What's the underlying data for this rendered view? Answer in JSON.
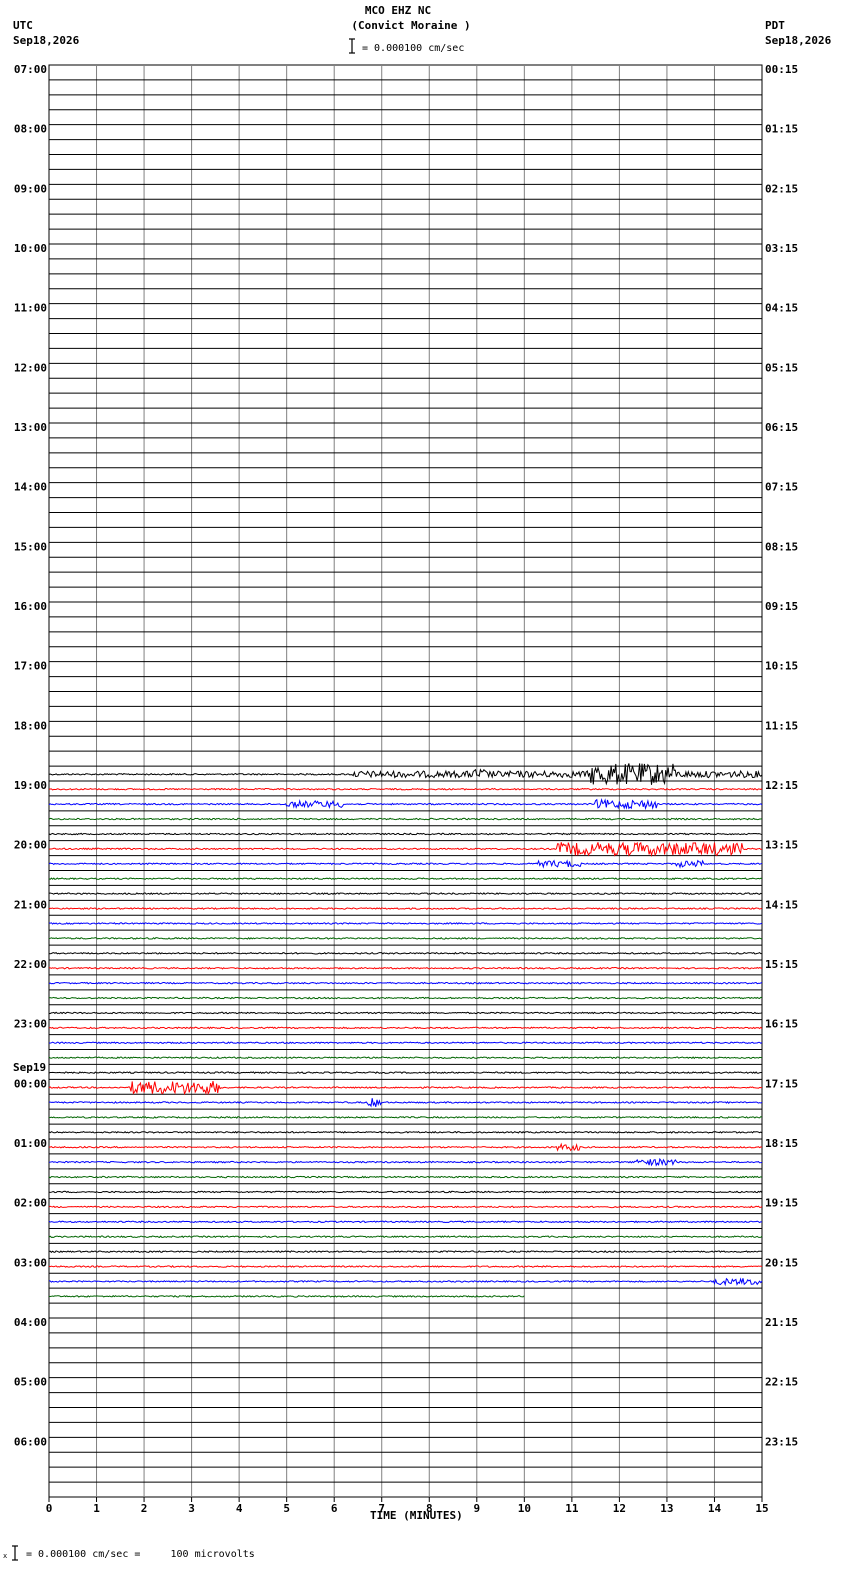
{
  "header": {
    "station": "MCO EHZ NC",
    "location": "(Convict Moraine )",
    "scale": "= 0.000100 cm/sec",
    "left_tz": "UTC",
    "left_date": "Sep18,2026",
    "right_tz": "PDT",
    "right_date": "Sep18,2026",
    "day_change": "Sep19"
  },
  "footer": {
    "scale_note": "= 0.000100 cm/sec =     100 microvolts"
  },
  "colors": {
    "trace_cycle": [
      "#000000",
      "#ff0000",
      "#0000ff",
      "#006400"
    ],
    "grid": "#000000",
    "minute_lines": "#808080"
  },
  "chart_data": {
    "type": "line",
    "title": "MCO EHZ NC (Convict Moraine )",
    "xlabel": "TIME (MINUTES)",
    "ylabel": "",
    "xlim": [
      0,
      15
    ],
    "x_ticks": [
      "0",
      "1",
      "2",
      "3",
      "4",
      "5",
      "6",
      "7",
      "8",
      "9",
      "10",
      "11",
      "12",
      "13",
      "14",
      "15"
    ],
    "rows_per_hour": 4,
    "minutes_per_row": 15,
    "utc_hour_labels": [
      "07:00",
      "08:00",
      "09:00",
      "10:00",
      "11:00",
      "12:00",
      "13:00",
      "14:00",
      "15:00",
      "16:00",
      "17:00",
      "18:00",
      "19:00",
      "20:00",
      "21:00",
      "22:00",
      "23:00",
      "00:00",
      "01:00",
      "02:00",
      "03:00",
      "04:00",
      "05:00",
      "06:00"
    ],
    "pdt_hour_labels": [
      "00:15",
      "01:15",
      "02:15",
      "03:15",
      "04:15",
      "05:15",
      "06:15",
      "07:15",
      "08:15",
      "09:15",
      "10:15",
      "11:15",
      "12:15",
      "13:15",
      "14:15",
      "15:15",
      "16:15",
      "17:15",
      "18:15",
      "19:15",
      "20:15",
      "21:15",
      "22:15",
      "23:15"
    ],
    "trace_rows": {
      "first_row": 47,
      "last_row": 82,
      "last_row_end_minute": 10
    },
    "events": [
      {
        "row": 47,
        "start_min": 6.4,
        "end_min": 15,
        "level": 3,
        "note": "green burst"
      },
      {
        "row": 47,
        "start_min": 11.4,
        "end_min": 13.2,
        "level": 10
      },
      {
        "row": 47,
        "start_min": 8.9,
        "end_min": 9.2,
        "level": 5
      },
      {
        "row": 49,
        "start_min": 5.0,
        "end_min": 6.2,
        "level": 3
      },
      {
        "row": 49,
        "start_min": 11.5,
        "end_min": 12.8,
        "level": 4
      },
      {
        "row": 52,
        "start_min": 10.7,
        "end_min": 14.6,
        "level": 6
      },
      {
        "row": 53,
        "start_min": 10.3,
        "end_min": 11.2,
        "level": 3
      },
      {
        "row": 53,
        "start_min": 13.2,
        "end_min": 13.8,
        "level": 3
      },
      {
        "row": 68,
        "start_min": 1.7,
        "end_min": 3.6,
        "level": 6
      },
      {
        "row": 69,
        "start_min": 6.7,
        "end_min": 7.0,
        "level": 4
      },
      {
        "row": 73,
        "start_min": 12.3,
        "end_min": 13.2,
        "level": 3
      },
      {
        "row": 72,
        "start_min": 10.7,
        "end_min": 11.2,
        "level": 3
      },
      {
        "row": 81,
        "start_min": 14.0,
        "end_min": 15,
        "level": 3
      }
    ]
  }
}
